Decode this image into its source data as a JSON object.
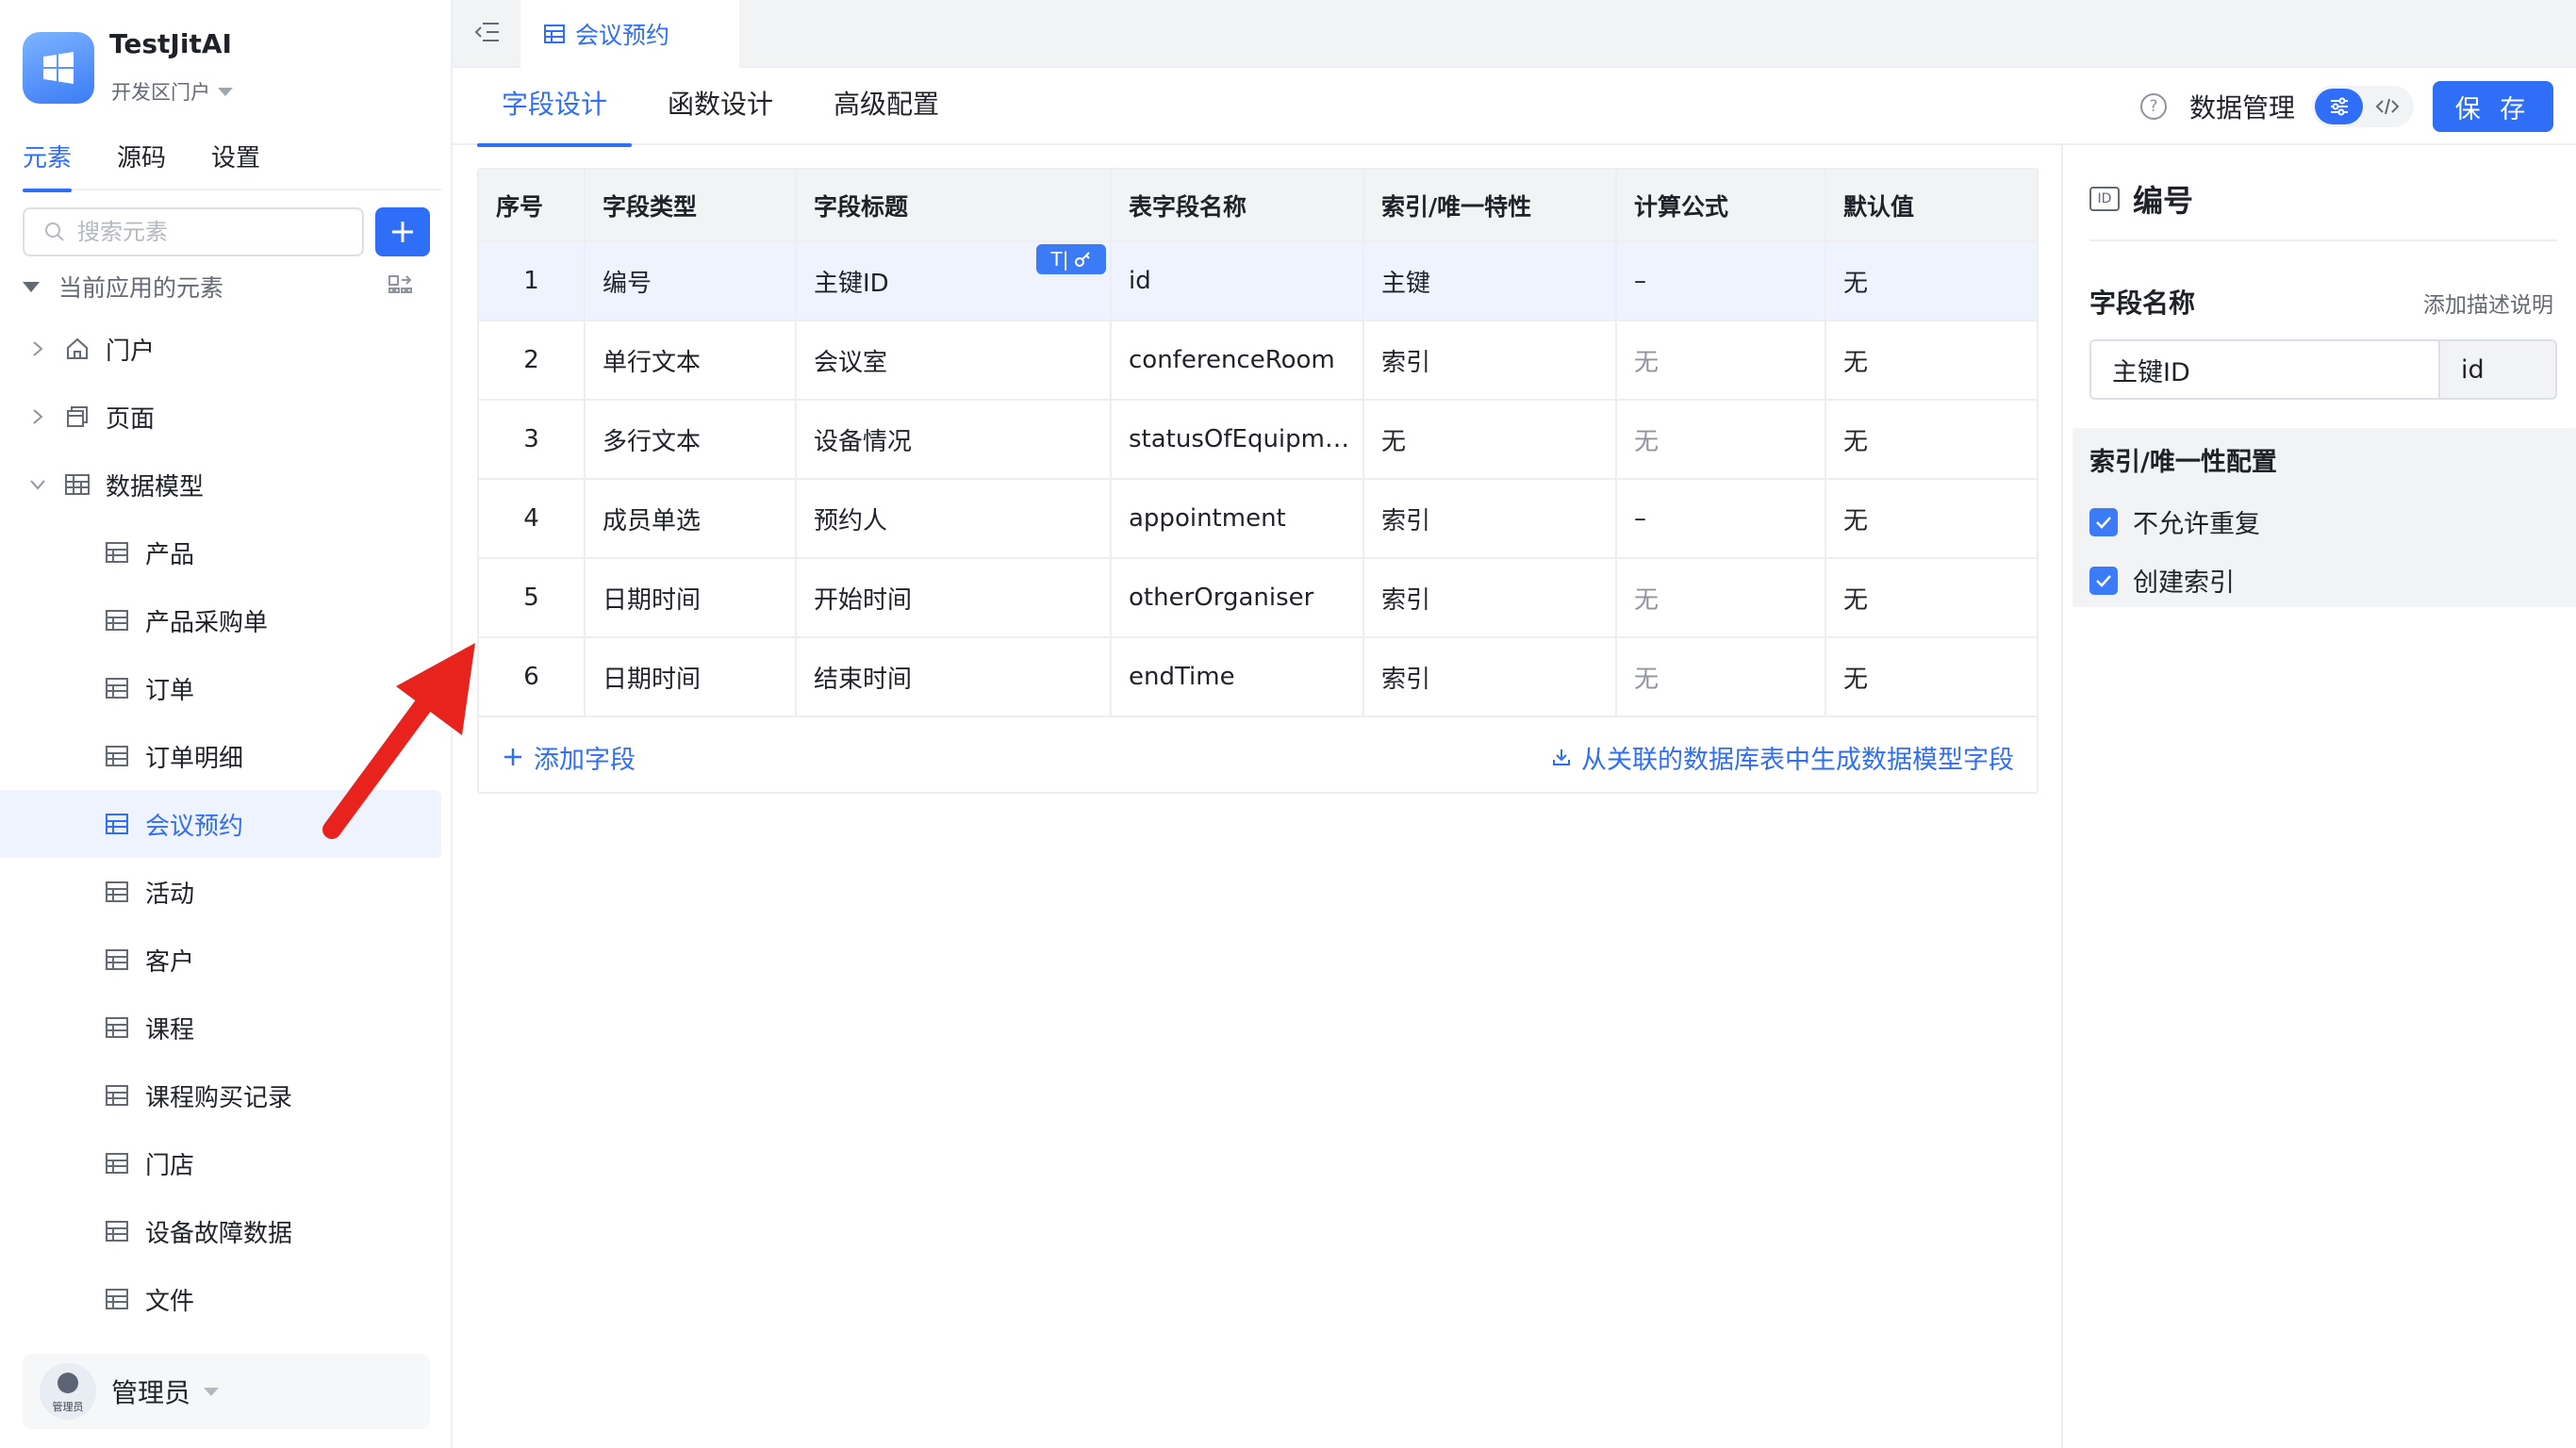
{
  "app": {
    "name": "TestJitAI",
    "portal": "开发区门户"
  },
  "sidebar": {
    "tabs": [
      "元素",
      "源码",
      "设置"
    ],
    "search_placeholder": "搜索元素",
    "group_label": "当前应用的元素",
    "tree": [
      {
        "label": "门户",
        "level": 1,
        "icon": "home-icon"
      },
      {
        "label": "页面",
        "level": 1,
        "icon": "page-icon"
      },
      {
        "label": "数据模型",
        "level": 1,
        "icon": "table-icon",
        "expanded": true
      },
      {
        "label": "产品",
        "level": 2
      },
      {
        "label": "产品采购单",
        "level": 2
      },
      {
        "label": "订单",
        "level": 2
      },
      {
        "label": "订单明细",
        "level": 2
      },
      {
        "label": "会议预约",
        "level": 2,
        "selected": true
      },
      {
        "label": "活动",
        "level": 2
      },
      {
        "label": "客户",
        "level": 2
      },
      {
        "label": "课程",
        "level": 2
      },
      {
        "label": "课程购买记录",
        "level": 2
      },
      {
        "label": "门店",
        "level": 2
      },
      {
        "label": "设备故障数据",
        "level": 2
      },
      {
        "label": "文件",
        "level": 2
      }
    ],
    "user": {
      "name": "管理员",
      "avatar_text": "管理员"
    }
  },
  "topbar": {
    "tab_label": "会议预约"
  },
  "subtabs": {
    "tabs": [
      "字段设计",
      "函数设计",
      "高级配置"
    ],
    "active": 0,
    "data_mgmt": "数据管理",
    "save": "保 存"
  },
  "table": {
    "headers": [
      "序号",
      "字段类型",
      "字段标题",
      "表字段名称",
      "索引/唯一特性",
      "计算公式",
      "默认值"
    ],
    "rows": [
      [
        "1",
        "编号",
        "主键ID",
        "id",
        "主键",
        "–",
        "无"
      ],
      [
        "2",
        "单行文本",
        "会议室",
        "conferenceRoom",
        "索引",
        "无",
        "无"
      ],
      [
        "3",
        "多行文本",
        "设备情况",
        "statusOfEquipment",
        "无",
        "无",
        "无"
      ],
      [
        "4",
        "成员单选",
        "预约人",
        "appointment",
        "索引",
        "–",
        "无"
      ],
      [
        "5",
        "日期时间",
        "开始时间",
        "otherOrganiser",
        "索引",
        "无",
        "无"
      ],
      [
        "6",
        "日期时间",
        "结束时间",
        "endTime",
        "索引",
        "无",
        "无"
      ]
    ],
    "badge_text": "T|",
    "add_field": "添加字段",
    "generate_fields": "从关联的数据库表中生成数据模型字段"
  },
  "panel": {
    "id_chip": "ID",
    "title": "编号",
    "field_name_label": "字段名称",
    "add_description": "添加描述说明",
    "field_title_value": "主键ID",
    "field_name_value": "id",
    "index_config_title": "索引/唯一性配置",
    "options": [
      {
        "label": "不允许重复",
        "checked": true
      },
      {
        "label": "创建索引",
        "checked": true
      }
    ]
  },
  "colors": {
    "accent": "#2f6ef6",
    "selected_row": "#eef3fe",
    "arrow": "#e8231e"
  }
}
